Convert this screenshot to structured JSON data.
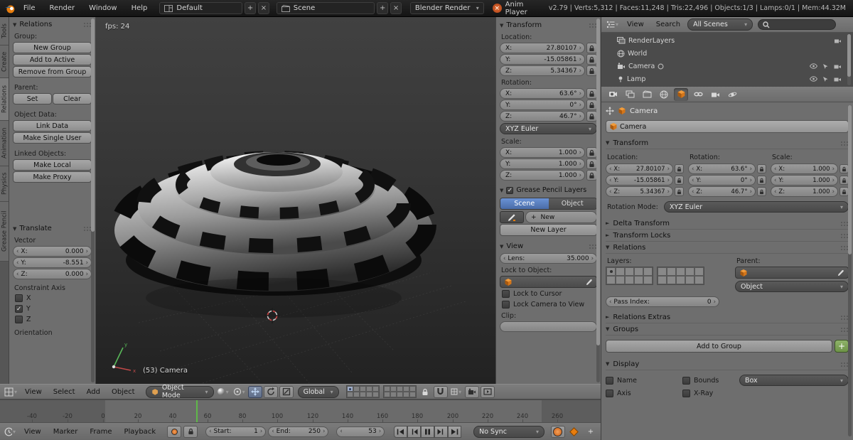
{
  "glyphs": {
    "collapse": "▼",
    "expand": "►",
    "dropdown": "▾",
    "spin_left": "‹",
    "spin_right": "›",
    "check": "✓",
    "plus": "+",
    "close": "×"
  },
  "colors": {
    "accent_blue": "#5680c2",
    "accent_orange": "#e87d0d",
    "current_frame_green": "#5fb849"
  },
  "topbar": {
    "menus": [
      "File",
      "Render",
      "Window",
      "Help"
    ],
    "layout_value": "Default",
    "scene_value": "Scene",
    "engine_value": "Blender Render",
    "anim_player_label": "Anim Player",
    "stats": "v2.79 | Verts:5,312 | Faces:11,248 | Tris:22,496 | Objects:1/3 | Lamps:0/1 | Mem:44.32M"
  },
  "tool_tabs": [
    "Tools",
    "Create",
    "Relations",
    "Animation",
    "Physics",
    "Grease Pencil"
  ],
  "tool_shelf": {
    "relations": {
      "title": "Relations",
      "group_label": "Group:",
      "new_group": "New Group",
      "add_to_active": "Add to Active",
      "remove_from_group": "Remove from Group",
      "parent_label": "Parent:",
      "set": "Set",
      "clear": "Clear",
      "object_data_label": "Object Data:",
      "link_data": "Link Data",
      "make_single_user": "Make Single User",
      "linked_label": "Linked Objects:",
      "make_local": "Make Local",
      "make_proxy": "Make Proxy"
    },
    "translate": {
      "title": "Translate",
      "vector_label": "Vector",
      "fields": [
        {
          "label": "X:",
          "value": "0.000"
        },
        {
          "label": "Y:",
          "value": "-8.551"
        },
        {
          "label": "Z:",
          "value": "0.000"
        }
      ],
      "constraint_label": "Constraint Axis",
      "axes": [
        {
          "label": "X",
          "checked": false
        },
        {
          "label": "Y",
          "checked": true
        },
        {
          "label": "Z",
          "checked": false
        }
      ],
      "orientation_label": "Orientation"
    }
  },
  "viewport": {
    "fps": "fps: 24",
    "camera_label": "(53) Camera"
  },
  "viewport_header": {
    "menus": [
      "View",
      "Select",
      "Add",
      "Object"
    ],
    "mode": "Object Mode",
    "orientation": "Global"
  },
  "n_panel": {
    "transform": {
      "title": "Transform",
      "location_label": "Location:",
      "location": [
        {
          "label": "X:",
          "value": "27.80107"
        },
        {
          "label": "Y:",
          "value": "-15.05861"
        },
        {
          "label": "Z:",
          "value": "5.34367"
        }
      ],
      "rotation_label": "Rotation:",
      "rotation": [
        {
          "label": "X:",
          "value": "63.6°"
        },
        {
          "label": "Y:",
          "value": "0°"
        },
        {
          "label": "Z:",
          "value": "46.7°"
        }
      ],
      "rotation_mode": "XYZ Euler",
      "scale_label": "Scale:",
      "scale": [
        {
          "label": "X:",
          "value": "1.000"
        },
        {
          "label": "Y:",
          "value": "1.000"
        },
        {
          "label": "Z:",
          "value": "1.000"
        }
      ]
    },
    "grease_pencil": {
      "title": "Grease Pencil Layers",
      "tab_scene": "Scene",
      "tab_object": "Object",
      "new_button": "New",
      "new_layer_button": "New Layer"
    },
    "view": {
      "title": "View",
      "lens_label": "Lens:",
      "lens_value": "35.000",
      "lock_object_label": "Lock to Object:",
      "lock_cursor_label": "Lock to Cursor",
      "lock_camera_label": "Lock Camera to View",
      "clip_label": "Clip:"
    }
  },
  "outliner": {
    "view": "View",
    "search": "Search",
    "scenes_filter": "All Scenes",
    "items": [
      "RenderLayers",
      "World",
      "Camera",
      "Lamp"
    ]
  },
  "properties": {
    "breadcrumb": "Camera",
    "name_value": "Camera",
    "transform": {
      "title": "Transform",
      "location_label": "Location:",
      "rotation_label": "Rotation:",
      "scale_label": "Scale:",
      "location": [
        {
          "label": "X:",
          "value": "27.80107"
        },
        {
          "label": "Y:",
          "value": "-15.05861"
        },
        {
          "label": "Z:",
          "value": "5.34367"
        }
      ],
      "rotation": [
        {
          "label": "X:",
          "value": "63.6°"
        },
        {
          "label": "Y:",
          "value": "0°"
        },
        {
          "label": "Z:",
          "value": "46.7°"
        }
      ],
      "scale": [
        {
          "label": "X:",
          "value": "1.000"
        },
        {
          "label": "Y:",
          "value": "1.000"
        },
        {
          "label": "Z:",
          "value": "1.000"
        }
      ],
      "rotation_mode_label": "Rotation Mode:",
      "rotation_mode": "XYZ Euler"
    },
    "delta_transform_title": "Delta Transform",
    "transform_locks_title": "Transform Locks",
    "relations": {
      "title": "Relations",
      "layers_label": "Layers:",
      "parent_label": "Parent:",
      "parent_type": "Object",
      "pass_index_label": "Pass Index:",
      "pass_index_value": "0"
    },
    "relations_extras_title": "Relations Extras",
    "groups": {
      "title": "Groups",
      "add_to_group": "Add to Group"
    },
    "display": {
      "title": "Display",
      "name_label": "Name",
      "bounds_label": "Bounds",
      "bounds_type": "Box",
      "axis_label": "Axis",
      "xray_label": "X-Ray"
    }
  },
  "timeline": {
    "menus": [
      "View",
      "Marker",
      "Frame",
      "Playback"
    ],
    "ruler_ticks": [
      "-40",
      "-20",
      "0",
      "20",
      "40",
      "60",
      "80",
      "100",
      "120",
      "140",
      "160",
      "180",
      "200",
      "220",
      "240",
      "260"
    ],
    "start_label": "Start:",
    "start_value": "1",
    "end_label": "End:",
    "end_value": "250",
    "current_frame": "53",
    "sync": "No Sync",
    "playback": [
      "jump-to-start",
      "previous-keyframe",
      "pause",
      "next-keyframe",
      "jump-to-end"
    ]
  }
}
